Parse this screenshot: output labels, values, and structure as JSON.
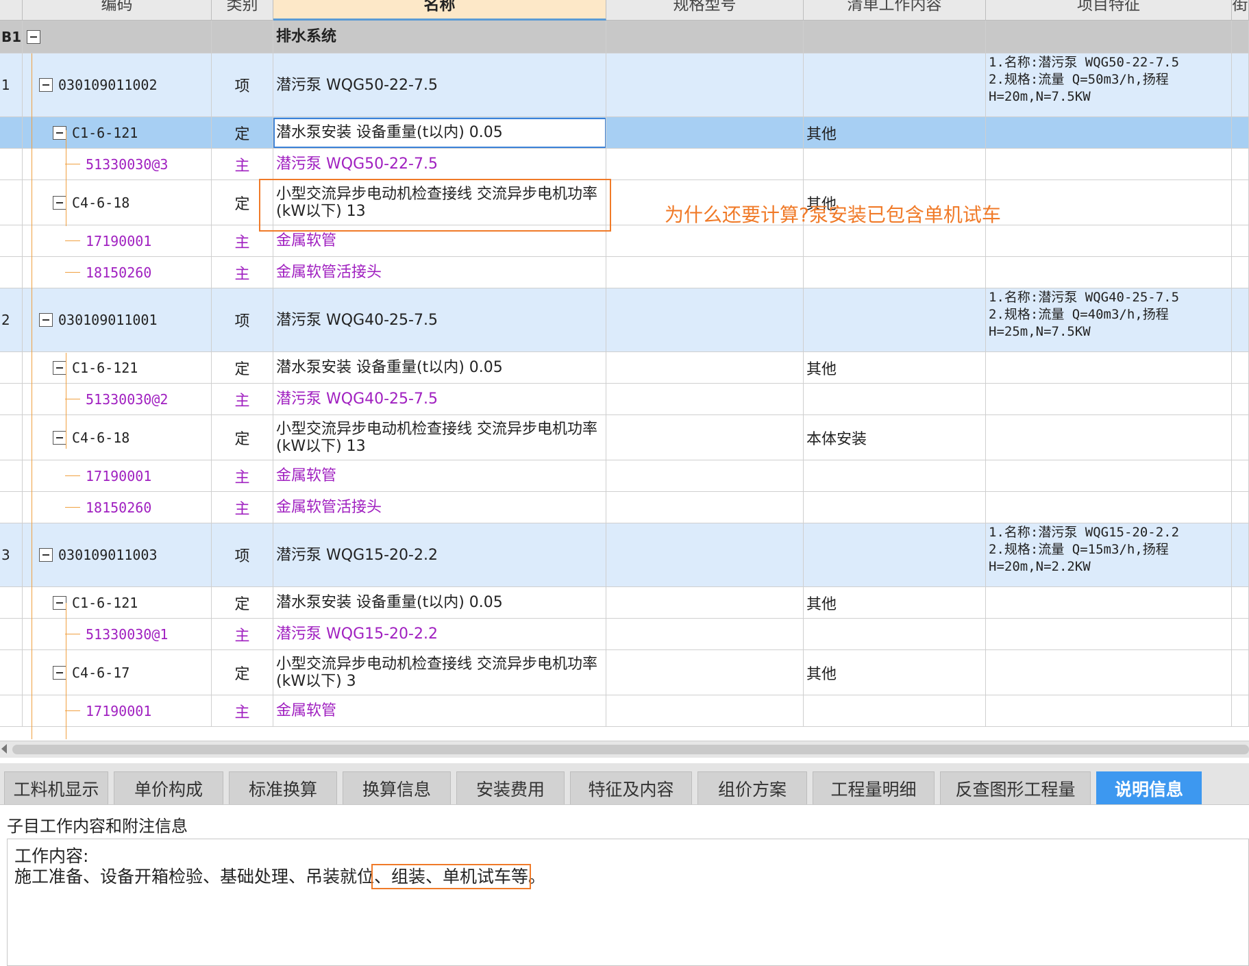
{
  "columns": {
    "code": "编码",
    "type": "类别",
    "name": "名称",
    "spec": "规格型号",
    "work": "清单工作内容",
    "feature": "项目特征",
    "extra": "街"
  },
  "group": {
    "idx": "B1",
    "name": "排水系统"
  },
  "rows": [
    {
      "idx": "1",
      "code": "030109011002",
      "type": "项",
      "name": "潜污泵 WQG50-22-7.5",
      "spec": "",
      "work": "",
      "feature": "1.名称:潜污泵 WQG50-22-7.5\n2.规格:流量 Q=50m3/h,扬程 H=20m,N=7.5KW"
    },
    {
      "idx": "",
      "code": "C1-6-121",
      "type": "定",
      "name": "潜水泵安装 设备重量(t以内) 0.05",
      "spec": "",
      "work": "其他",
      "feature": ""
    },
    {
      "idx": "",
      "code": "51330030@3",
      "type": "主",
      "name": "潜污泵 WQG50-22-7.5",
      "spec": "",
      "work": "",
      "feature": ""
    },
    {
      "idx": "",
      "code": "C4-6-18",
      "type": "定",
      "name": "小型交流异步电动机检查接线 交流异步电机功率(kW以下) 13",
      "spec": "",
      "work": "其他",
      "feature": ""
    },
    {
      "idx": "",
      "code": "17190001",
      "type": "主",
      "name": "金属软管",
      "spec": "",
      "work": "",
      "feature": ""
    },
    {
      "idx": "",
      "code": "18150260",
      "type": "主",
      "name": "金属软管活接头",
      "spec": "",
      "work": "",
      "feature": ""
    },
    {
      "idx": "2",
      "code": "030109011001",
      "type": "项",
      "name": "潜污泵 WQG40-25-7.5",
      "spec": "",
      "work": "",
      "feature": "1.名称:潜污泵 WQG40-25-7.5\n2.规格:流量 Q=40m3/h,扬程 H=25m,N=7.5KW"
    },
    {
      "idx": "",
      "code": "C1-6-121",
      "type": "定",
      "name": "潜水泵安装 设备重量(t以内) 0.05",
      "spec": "",
      "work": "其他",
      "feature": ""
    },
    {
      "idx": "",
      "code": "51330030@2",
      "type": "主",
      "name": "潜污泵 WQG40-25-7.5",
      "spec": "",
      "work": "",
      "feature": ""
    },
    {
      "idx": "",
      "code": "C4-6-18",
      "type": "定",
      "name": "小型交流异步电动机检查接线 交流异步电机功率(kW以下) 13",
      "spec": "",
      "work": "本体安装",
      "feature": ""
    },
    {
      "idx": "",
      "code": "17190001",
      "type": "主",
      "name": "金属软管",
      "spec": "",
      "work": "",
      "feature": ""
    },
    {
      "idx": "",
      "code": "18150260",
      "type": "主",
      "name": "金属软管活接头",
      "spec": "",
      "work": "",
      "feature": ""
    },
    {
      "idx": "3",
      "code": "030109011003",
      "type": "项",
      "name": "潜污泵 WQG15-20-2.2",
      "spec": "",
      "work": "",
      "feature": "1.名称:潜污泵 WQG15-20-2.2\n2.规格:流量 Q=15m3/h,扬程 H=20m,N=2.2KW"
    },
    {
      "idx": "",
      "code": "C1-6-121",
      "type": "定",
      "name": "潜水泵安装 设备重量(t以内) 0.05",
      "spec": "",
      "work": "其他",
      "feature": ""
    },
    {
      "idx": "",
      "code": "51330030@1",
      "type": "主",
      "name": "潜污泵 WQG15-20-2.2",
      "spec": "",
      "work": "",
      "feature": ""
    },
    {
      "idx": "",
      "code": "C4-6-17",
      "type": "定",
      "name": "小型交流异步电动机检查接线 交流异步电机功率(kW以下) 3",
      "spec": "",
      "work": "其他",
      "feature": ""
    },
    {
      "idx": "",
      "code": "17190001",
      "type": "主",
      "name": "金属软管",
      "spec": "",
      "work": "",
      "feature": ""
    }
  ],
  "annotation": "为什么还要计算?泵安装已包含单机试车",
  "tabs": [
    "工料机显示",
    "单价构成",
    "标准换算",
    "换算信息",
    "安装费用",
    "特征及内容",
    "组价方案",
    "工程量明细",
    "反查图形工程量",
    "说明信息"
  ],
  "active_tab": "说明信息",
  "info": {
    "title": "子目工作内容和附注信息",
    "heading": "工作内容:",
    "text_before": "施工准备、设备开箱检验、基础处理、吊装就位",
    "text_highlight": "、组装、单机试车等",
    "text_after": "。"
  },
  "colors": {
    "purple_text": "#a020c0",
    "item_row": "#dcebfb",
    "selected_row": "#a7cff3",
    "annotation": "#f07a28",
    "active_tab": "#3d98f0"
  }
}
